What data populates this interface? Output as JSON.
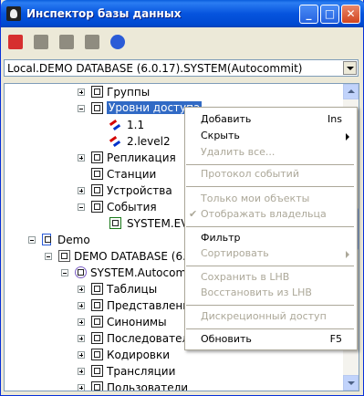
{
  "window": {
    "title": "Инспектор базы данных"
  },
  "title_buttons": {
    "minimize": "_",
    "maximize": "□",
    "close": "✕"
  },
  "toolbar": {
    "icons": [
      "add-icon",
      "user-icon",
      "lock-icon",
      "table-icon",
      "connect-icon"
    ],
    "colors": [
      "#d62f2f",
      "#8f8c80",
      "#8f8c80",
      "#8f8c80",
      "#2a5bd7"
    ]
  },
  "connection": {
    "value": "Local.DEMO DATABASE (6.0.17).SYSTEM(Autocommit)"
  },
  "tree": {
    "groups": "Группы",
    "access_levels": "Уровни доступа",
    "level_1": "1.1",
    "level_2": "2.level2",
    "replication": "Репликация",
    "stations": "Станции",
    "devices": "Устройства",
    "events": "События",
    "system_events": "SYSTEM.EV",
    "demo": "Demo",
    "demo_database": "DEMO DATABASE (6.",
    "system_autocommit": "SYSTEM.Autocom",
    "tables": "Таблицы",
    "views": "Представлени",
    "synonyms": "Синонимы",
    "sequences": "Последовател",
    "encodings": "Кодировки",
    "translations": "Трансляции",
    "users": "Пользователи"
  },
  "context_menu": {
    "add": "Добавить",
    "add_shortcut": "Ins",
    "hide": "Скрыть",
    "delete_all": "Удалить все...",
    "event_log": "Протокол событий",
    "only_my_objects": "Только мои объекты",
    "show_owner": "Отображать владельца",
    "filter": "Фильтр",
    "sort": "Сортировать",
    "save_lhb": "Сохранить в LHB",
    "restore_lhb": "Восстановить из LHB",
    "discretionary_access": "Дискреционный доступ",
    "refresh": "Обновить",
    "refresh_shortcut": "F5"
  }
}
